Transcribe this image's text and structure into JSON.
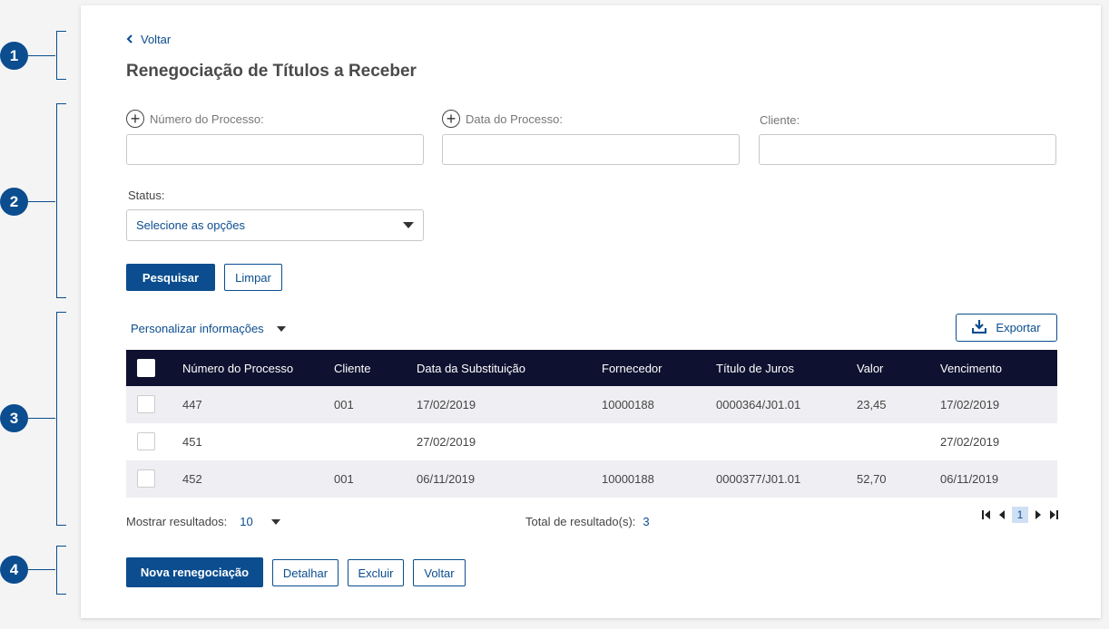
{
  "markers": [
    "1",
    "2",
    "3",
    "4"
  ],
  "header": {
    "back_label": "Voltar",
    "title": "Renegociação de Títulos a Receber"
  },
  "filters": {
    "process_number_label": "Número do Processo:",
    "process_date_label": "Data do Processo:",
    "client_label": "Cliente:",
    "status_label": "Status:",
    "status_value": "Selecione as opções",
    "search_label": "Pesquisar",
    "clear_label": "Limpar"
  },
  "toolbar": {
    "customize_label": "Personalizar informações",
    "export_label": "Exportar"
  },
  "table": {
    "columns": [
      "Número do Processo",
      "Cliente",
      "Data da Substituição",
      "Fornecedor",
      "Título de Juros",
      "Valor",
      "Vencimento"
    ],
    "rows": [
      [
        "447",
        "001",
        "17/02/2019",
        "10000188",
        "0000364/J01.01",
        "23,45",
        "17/02/2019"
      ],
      [
        "451",
        "",
        "27/02/2019",
        "",
        "",
        "",
        "27/02/2019"
      ],
      [
        "452",
        "001",
        "06/11/2019",
        "10000188",
        "0000377/J01.01",
        "52,70",
        "06/11/2019"
      ]
    ]
  },
  "footer": {
    "show_results_label": "Mostrar resultados:",
    "page_size": "10",
    "total_label": "Total de resultado(s):",
    "total_value": "3",
    "current_page": "1"
  },
  "actions": {
    "new_label": "Nova renegociação",
    "detail_label": "Detalhar",
    "delete_label": "Excluir",
    "back_label": "Voltar"
  },
  "colors": {
    "primary": "#0b4d8f",
    "table_header": "#0e1130",
    "stripe": "#efeff3"
  }
}
